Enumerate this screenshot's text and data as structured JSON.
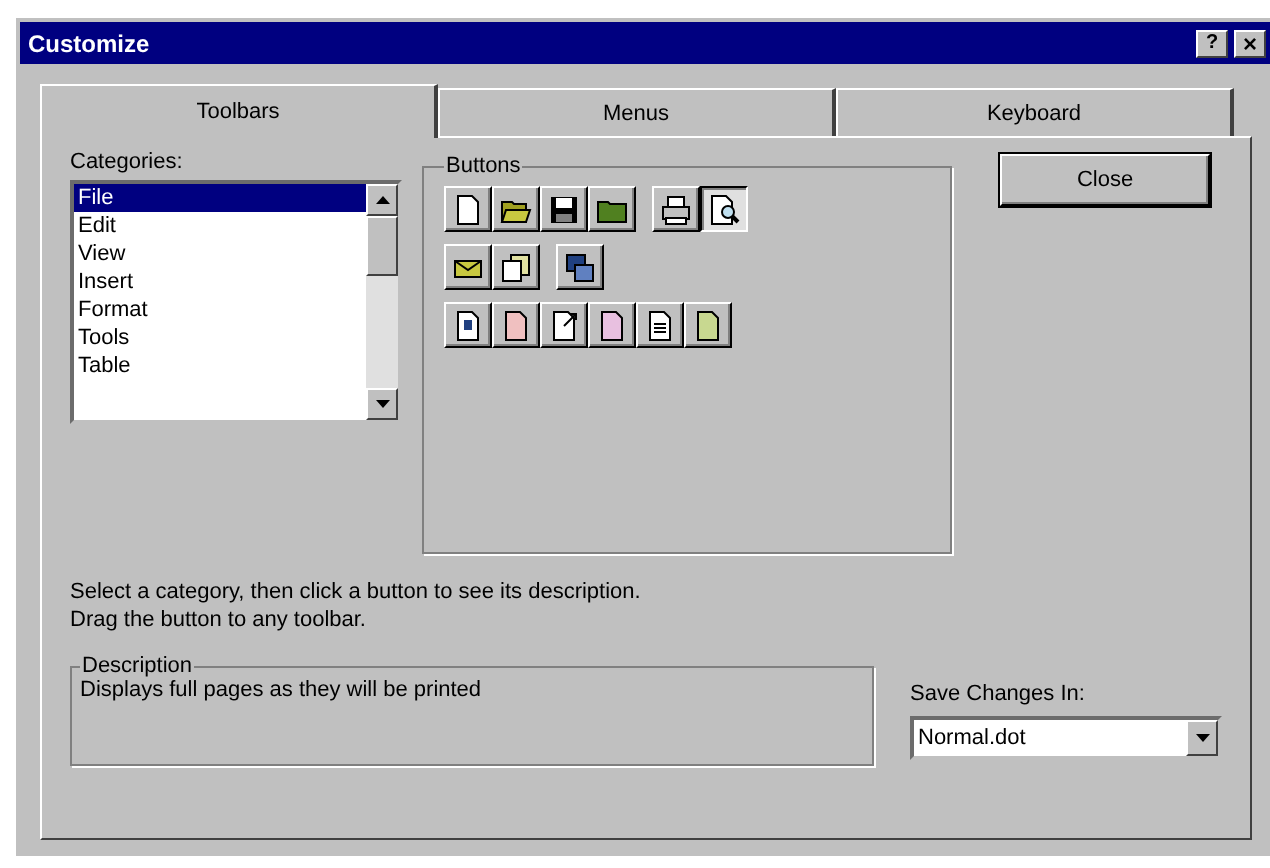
{
  "window": {
    "title": "Customize",
    "controls": [
      {
        "kind": "help",
        "label": "?"
      },
      {
        "kind": "close",
        "label": "×"
      }
    ]
  },
  "tabs": [
    {
      "label": "Toolbars",
      "selected": true
    },
    {
      "label": "Menus",
      "selected": false
    },
    {
      "label": "Keyboard",
      "selected": false
    }
  ],
  "categories": {
    "label": "Categories:",
    "items": [
      {
        "label": "File",
        "selected": true
      },
      {
        "label": "Edit",
        "selected": false
      },
      {
        "label": "View",
        "selected": false
      },
      {
        "label": "Insert",
        "selected": false
      },
      {
        "label": "Format",
        "selected": false
      },
      {
        "label": "Tools",
        "selected": false
      },
      {
        "label": "Table",
        "selected": false
      }
    ]
  },
  "buttons_group": {
    "label": "Buttons",
    "rows": [
      [
        {
          "kind": "page",
          "pressed": false
        },
        {
          "kind": "open-folder",
          "pressed": false
        },
        {
          "kind": "disk",
          "pressed": false
        },
        {
          "kind": "folder",
          "pressed": false
        },
        {
          "kind": "gap"
        },
        {
          "kind": "printer",
          "pressed": false
        },
        {
          "kind": "preview",
          "pressed": true
        }
      ],
      [
        {
          "kind": "envelope",
          "pressed": false
        },
        {
          "kind": "stack",
          "pressed": false
        },
        {
          "kind": "gap"
        },
        {
          "kind": "windows",
          "pressed": false
        }
      ],
      [
        {
          "kind": "page-person",
          "pressed": false
        },
        {
          "kind": "page-red",
          "pressed": false
        },
        {
          "kind": "page-arrow",
          "pressed": false
        },
        {
          "kind": "page-pink",
          "pressed": false
        },
        {
          "kind": "page-lines",
          "pressed": false
        },
        {
          "kind": "page-green",
          "pressed": false
        }
      ]
    ]
  },
  "close_button": "Close",
  "hint": [
    "Select a category, then click a button to see its description.",
    "Drag the button to any toolbar."
  ],
  "description": {
    "label": "Description",
    "text": "Displays full pages as they will be printed"
  },
  "save_changes": {
    "label": "Save Changes In:",
    "value": "Normal.dot"
  }
}
